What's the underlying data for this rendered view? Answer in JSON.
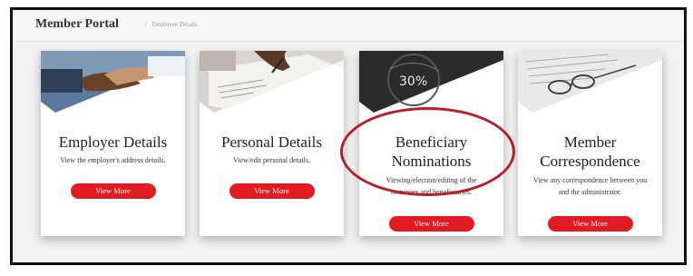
{
  "header": {
    "title": "Member Portal",
    "breadcrumb_sep": "/",
    "breadcrumb_current": "Employee Details"
  },
  "cards": [
    {
      "title_line1": "Employer Details",
      "desc_line1": "View the employer's address details.",
      "button": "View More",
      "image_icon": "handshake-image"
    },
    {
      "title_line1": "Personal Details",
      "desc_line1": "View/edit personal details.",
      "button": "View More",
      "image_icon": "signing-document-image"
    },
    {
      "title_line1": "Beneficiary",
      "title_line2": "Nominations",
      "desc_line1": "Viewing/election/editing of the",
      "desc_line2": "nominees and beneficiaries.",
      "button": "View More",
      "image_icon": "percentage-dial-image",
      "image_text": "30%"
    },
    {
      "title_line1": "Member",
      "title_line2": "Correspondence",
      "desc_line1": "View any correspondence between you",
      "desc_line2": "and the administrator.",
      "button": "View More",
      "image_icon": "document-with-glasses-image"
    }
  ],
  "colors": {
    "accent": "#e01b22",
    "highlight": "#b3202a"
  }
}
